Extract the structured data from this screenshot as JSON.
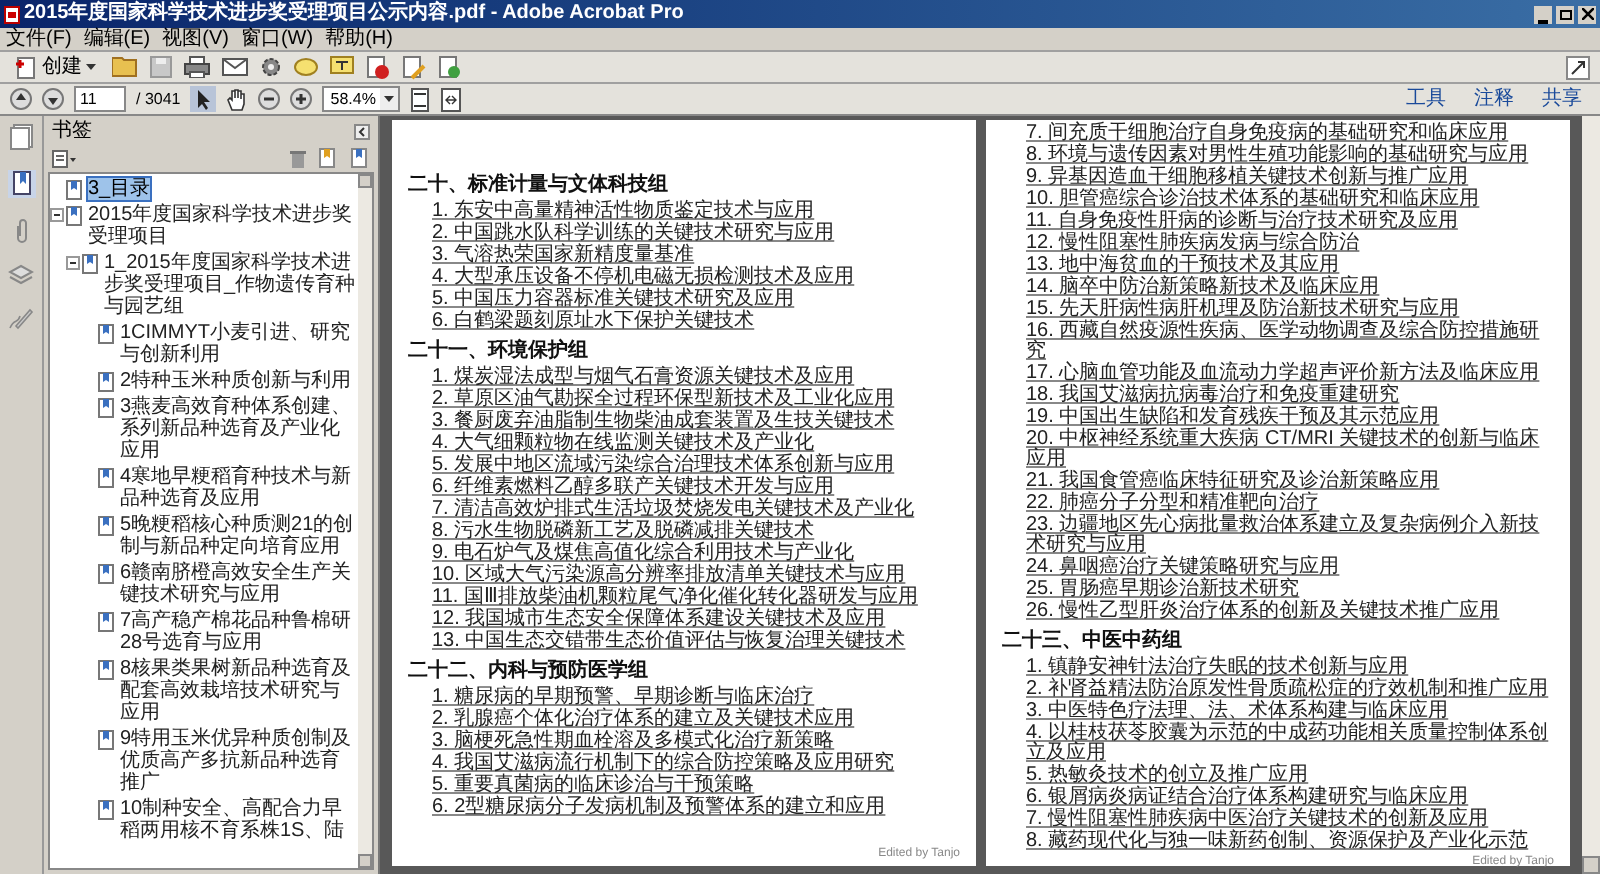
{
  "window": {
    "title": "2015年度国家科学技术进步奖受理项目公示内容.pdf - Adobe Acrobat Pro"
  },
  "menu": [
    "文件(F)",
    "编辑(E)",
    "视图(V)",
    "窗口(W)",
    "帮助(H)"
  ],
  "toolbar": {
    "create_label": "创建",
    "page_number": "11",
    "page_count": "/ 3041",
    "zoom": "58.4%",
    "right_buttons": [
      "工具",
      "注释",
      "共享"
    ]
  },
  "sidebar": {
    "title": "书签",
    "bookmarks": [
      {
        "label": "3_目录",
        "selected": true
      },
      {
        "label": "2015年度国家科学技术进步奖受理项目",
        "selected": false,
        "expanded": true,
        "children": [
          {
            "label": "1_2015年度国家科学技术进步奖受理项目_作物遗传育种与园艺组",
            "selected": false,
            "expanded": true,
            "children": [
              {
                "label": "1CIMMYT小麦引进、研究与创新利用",
                "selected": false
              },
              {
                "label": "2特种玉米种质创新与利用",
                "selected": false
              },
              {
                "label": "3燕麦高效育种体系创建、系列新品种选育及产业化应用",
                "selected": false
              },
              {
                "label": "4寒地早粳稻育种技术与新品种选育及应用",
                "selected": false
              },
              {
                "label": "5晚粳稻核心种质测21的创制与新品种定向培育应用",
                "selected": false
              },
              {
                "label": "6赣南脐橙高效安全生产关键技术研究与应用",
                "selected": false
              },
              {
                "label": "7高产稳产棉花品种鲁棉研28号选育与应用",
                "selected": false
              },
              {
                "label": "8核果类果树新品种选育及配套高效栽培技术研究与应用",
                "selected": false
              },
              {
                "label": "9特用玉米优异种质创制及优质高产多抗新品种选育推广",
                "selected": false
              },
              {
                "label": "10制种安全、高配合力早稻两用核不育系株1S、陆",
                "selected": false
              }
            ]
          }
        ]
      }
    ]
  },
  "pages": [
    {
      "blocks": [
        {
          "kind": "heading",
          "text": "二十、标准计量与文体科技组"
        },
        {
          "kind": "item",
          "text": "1. 东安中高量精神活性物质鉴定技术与应用"
        },
        {
          "kind": "item",
          "text": "2. 中国跳水队科学训练的关键技术研究与应用"
        },
        {
          "kind": "item",
          "text": "3. 气溶热荣国家新精度量基准"
        },
        {
          "kind": "item",
          "text": "4. 大型承压设备不停机电磁无损检测技术及应用"
        },
        {
          "kind": "item",
          "text": "5. 中国压力容器标准关键技术研究及应用"
        },
        {
          "kind": "item",
          "text": "6. 白鹤梁题刻原址水下保护关键技术"
        },
        {
          "kind": "heading",
          "text": "二十一、环境保护组"
        },
        {
          "kind": "item",
          "text": "1. 煤炭湿法成型与烟气石膏资源关键技术及应用"
        },
        {
          "kind": "item",
          "text": "2. 草原区油气勘探全过程环保型新技术及工业化应用"
        },
        {
          "kind": "item",
          "text": "3. 餐厨废弃油脂制生物柴油成套装置及生技关键技术"
        },
        {
          "kind": "item",
          "text": "4. 大气细颗粒物在线监测关键技术及产业化"
        },
        {
          "kind": "item",
          "text": "5. 发展中地区流域污染综合治理技术体系创新与应用"
        },
        {
          "kind": "item",
          "text": "6. 纤维素燃料乙醇多联产关键技术开发与应用"
        },
        {
          "kind": "item",
          "text": "7. 清洁高效炉排式生活垃圾焚烧发电关键技术及产业化"
        },
        {
          "kind": "item",
          "text": "8. 污水生物脱磷新工艺及脱磷减排关键技术"
        },
        {
          "kind": "item",
          "text": "9. 电石炉气及煤焦高值化综合利用技术与产业化"
        },
        {
          "kind": "item",
          "text": "10. 区域大气污染源高分辨率排放清单关键技术与应用"
        },
        {
          "kind": "item",
          "text": "11. 国Ⅲ排放柴油机颗粒尾气净化催化转化器研发与应用"
        },
        {
          "kind": "item",
          "text": "12. 我国城市生态安全保障体系建设关键技术及应用"
        },
        {
          "kind": "item",
          "text": "13. 中国生态交错带生态价值评估与恢复治理关键技术"
        },
        {
          "kind": "heading",
          "text": "二十二、内科与预防医学组"
        },
        {
          "kind": "item",
          "text": "1. 糖尿病的早期预警、早期诊断与临床治疗"
        },
        {
          "kind": "item",
          "text": "2. 乳腺癌个体化治疗体系的建立及关键技术应用"
        },
        {
          "kind": "item",
          "text": "3. 脑梗死急性期血栓溶及多模式化治疗新策略"
        },
        {
          "kind": "item",
          "text": "4. 我国艾滋病流行机制下的综合防控策略及应用研究"
        },
        {
          "kind": "item",
          "text": "5. 重要真菌病的临床诊治与干预策略"
        },
        {
          "kind": "item",
          "text": "6. 2型糖尿病分子发病机制及预警体系的建立和应用"
        }
      ],
      "footer": "Edited by Tanjo"
    },
    {
      "blocks": [
        {
          "kind": "item",
          "text": "7. 间充质干细胞治疗自身免疫病的基础研究和临床应用"
        },
        {
          "kind": "item",
          "text": "8. 环境与遗传因素对男性生殖功能影响的基础研究与应用"
        },
        {
          "kind": "item",
          "text": "9. 异基因造血干细胞移植关键技术创新与推广应用"
        },
        {
          "kind": "item",
          "text": "10. 胆管癌综合诊治技术体系的基础研究和临床应用"
        },
        {
          "kind": "item",
          "text": "11. 自身免疫性肝病的诊断与治疗技术研究及应用"
        },
        {
          "kind": "item",
          "text": "12. 慢性阻塞性肺疾病发病与综合防治"
        },
        {
          "kind": "item",
          "text": "13. 地中海贫血的干预技术及其应用"
        },
        {
          "kind": "item",
          "text": "14. 脑卒中防治新策略新技术及临床应用"
        },
        {
          "kind": "item",
          "text": "15. 先天肝病性病肝机理及防治新技术研究与应用"
        },
        {
          "kind": "item",
          "text": "16. 西藏自然疫源性疾病、医学动物调查及综合防控措施研究"
        },
        {
          "kind": "item",
          "text": "17. 心脑血管功能及血流动力学超声评价新方法及临床应用"
        },
        {
          "kind": "item",
          "text": "18. 我国艾滋病抗病毒治疗和免疫重建研究"
        },
        {
          "kind": "item",
          "text": "19. 中国出生缺陷和发育残疾干预及其示范应用"
        },
        {
          "kind": "item",
          "text": "20. 中枢神经系统重大疾病 CT/MRI 关键技术的创新与临床应用"
        },
        {
          "kind": "item",
          "text": "21. 我国食管癌临床特征研究及诊治新策略应用"
        },
        {
          "kind": "item",
          "text": "22. 肺癌分子分型和精准靶向治疗"
        },
        {
          "kind": "item",
          "text": "23. 边疆地区先心病批量救治体系建立及复杂病例介入新技术研究与应用"
        },
        {
          "kind": "item",
          "text": "24. 鼻咽癌治疗关键策略研究与应用"
        },
        {
          "kind": "item",
          "text": "25. 胃肠癌早期诊治新技术研究"
        },
        {
          "kind": "item",
          "text": "26. 慢性乙型肝炎治疗体系的创新及关键技术推广应用"
        },
        {
          "kind": "heading",
          "text": "二十三、中医中药组"
        },
        {
          "kind": "item",
          "text": "1. 镇静安神针法治疗失眠的技术创新与应用"
        },
        {
          "kind": "item",
          "text": "2. 补肾益精法防治原发性骨质疏松症的疗效机制和推广应用"
        },
        {
          "kind": "item",
          "text": "3. 中医特色疗法理、法、术体系构建与临床应用"
        },
        {
          "kind": "item",
          "text": "4. 以桂枝茯苓胶囊为示范的中成药功能相关质量控制体系创立及应用"
        },
        {
          "kind": "item",
          "text": "5. 热敏灸技术的创立及推广应用"
        },
        {
          "kind": "item",
          "text": "6. 银屑病炎病证结合治疗体系构建研究与临床应用"
        },
        {
          "kind": "item",
          "text": "7. 慢性阻塞性肺疾病中医治疗关键技术的创新及应用"
        },
        {
          "kind": "item",
          "text": "8. 藏药现代化与独一味新药创制、资源保护及产业化示范"
        }
      ],
      "footer": "Edited by Tanjo"
    }
  ]
}
